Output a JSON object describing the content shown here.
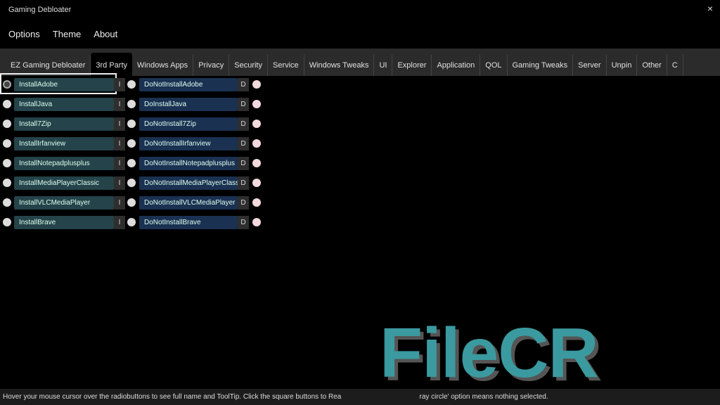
{
  "window": {
    "title": "Gaming Debloater",
    "close": "×"
  },
  "menu": [
    "Options",
    "Theme",
    "About"
  ],
  "tabs": [
    "EZ Gaming Debloater",
    "3rd Party",
    "Windows Apps",
    "Privacy",
    "Security",
    "Service",
    "Windows Tweaks",
    "UI",
    "Explorer",
    "Application",
    "QOL",
    "Gaming Tweaks",
    "Server",
    "Unpin",
    "Other",
    "C"
  ],
  "active_tab": "3rd Party",
  "rows": [
    {
      "install": "InstallAdobe",
      "donot": "DoNotInstallAdobe"
    },
    {
      "install": "InstallJava",
      "donot": "DoInstallJava"
    },
    {
      "install": "Install7Zip",
      "donot": "DoNotInstall7Zip"
    },
    {
      "install": "InstallIrfanview",
      "donot": "DoNotInstallIrfanview"
    },
    {
      "install": "InstallNotepadplusplus",
      "donot": "DoNotInstallNotepadplusplus"
    },
    {
      "install": "InstallMediaPlayerClassic",
      "donot": "DoNotInstallMediaPlayerClassic"
    },
    {
      "install": "InstallVLCMediaPlayer",
      "donot": "DoNotInstallVLCMediaPlayer"
    },
    {
      "install": "InstallBrave",
      "donot": "DoNotInstallBrave"
    }
  ],
  "buttons": {
    "install": "I",
    "donot": "D"
  },
  "status": "Hover your mouse cursor over the radiobuttons to see full name and ToolTip. Click the square buttons to Rea                                        ray circle' option means nothing selected.",
  "watermark": "FileCR"
}
